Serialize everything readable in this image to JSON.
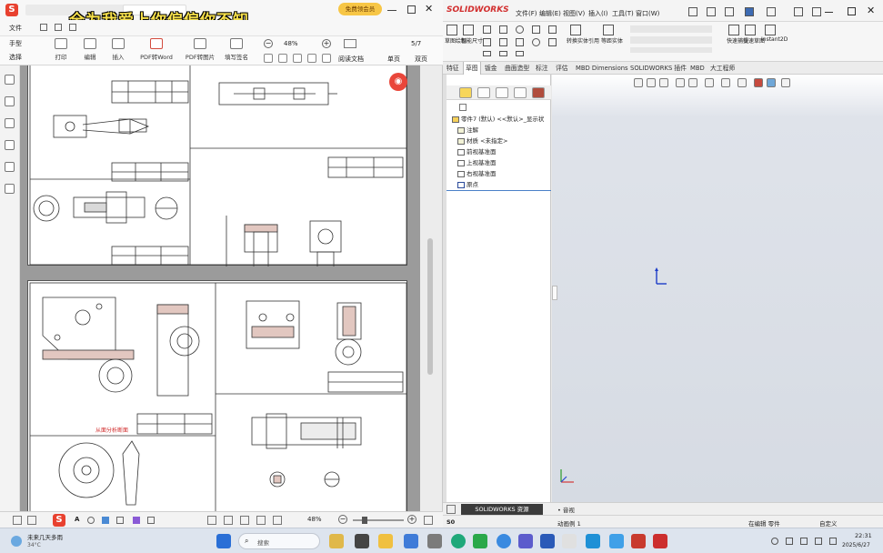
{
  "overlay": {
    "caption": "全为我爱上你偏偏你不知",
    "member_badge": "免费领会员"
  },
  "pdf_viewer": {
    "menu": {
      "file": "文件",
      "zoom_in_menu": "打开"
    },
    "toolbar": {
      "hand": "手型",
      "select": "选择",
      "print": "打印",
      "edit": "编辑",
      "insert": "插入",
      "to_word": "PDF转Word",
      "more_convert": "PDF转图片",
      "fill_sign": "填写签名",
      "zoom": "48%",
      "page": "5/7",
      "read_mode": "阅读文档",
      "screen": "单页",
      "scroll": "双页"
    },
    "status": {
      "zoom": "48%"
    },
    "drawings": {
      "title_block_1": [
        "名",
        "零件名称",
        "数",
        "比例"
      ],
      "title_block_2": [
        "班级",
        "图号",
        "数量",
        "比例"
      ],
      "title_block_3": [
        "零件",
        "上轴套"
      ],
      "red_note": "从面分析断面"
    }
  },
  "solidworks": {
    "logo": "SOLIDWORKS",
    "menu": [
      "文件(F)",
      "编辑(E)",
      "视图(V)",
      "插入(I)",
      "工具(T)",
      "窗口(W)"
    ],
    "ribbon": {
      "smart_dimension": "草图绘制",
      "smart_dim2": "智能尺寸",
      "convert": "转换实体引用",
      "offset": "等距实体",
      "fast_snap": "快速捕捉",
      "fast_view": "快速草图",
      "instant2d": "Instant2D"
    },
    "tabs": [
      "特征",
      "草图",
      "钣金",
      "曲面造型",
      "标注",
      "评估",
      "MBD Dimensions",
      "SOLIDWORKS 插件",
      "MBD",
      "大工程师"
    ],
    "active_tab": "草图",
    "tree": {
      "root": "零件7 (默认) <<默认>_显示状",
      "items": [
        "注解",
        "材质 <未指定>",
        "前视基准面",
        "上视基准面",
        "右视基准面",
        "原点"
      ]
    },
    "bottom_tab": "SOLIDWORKS 资源",
    "bottom_tab2": "• 音视",
    "model_tab": "动画例 1",
    "status": {
      "editing": "在编辑 零件",
      "units": "自定义"
    }
  },
  "taskbar": {
    "weather_title": "未来几天多雨",
    "weather_sub": "34°C",
    "search_placeholder": "搜索",
    "time": "22:31",
    "date": "2025/6/27"
  },
  "colors": {
    "pdf_accent": "#e8412f",
    "sw_red": "#d22f2f",
    "caption_yellow": "#f6e04b",
    "viewport_gray": "#d6dbe3"
  }
}
